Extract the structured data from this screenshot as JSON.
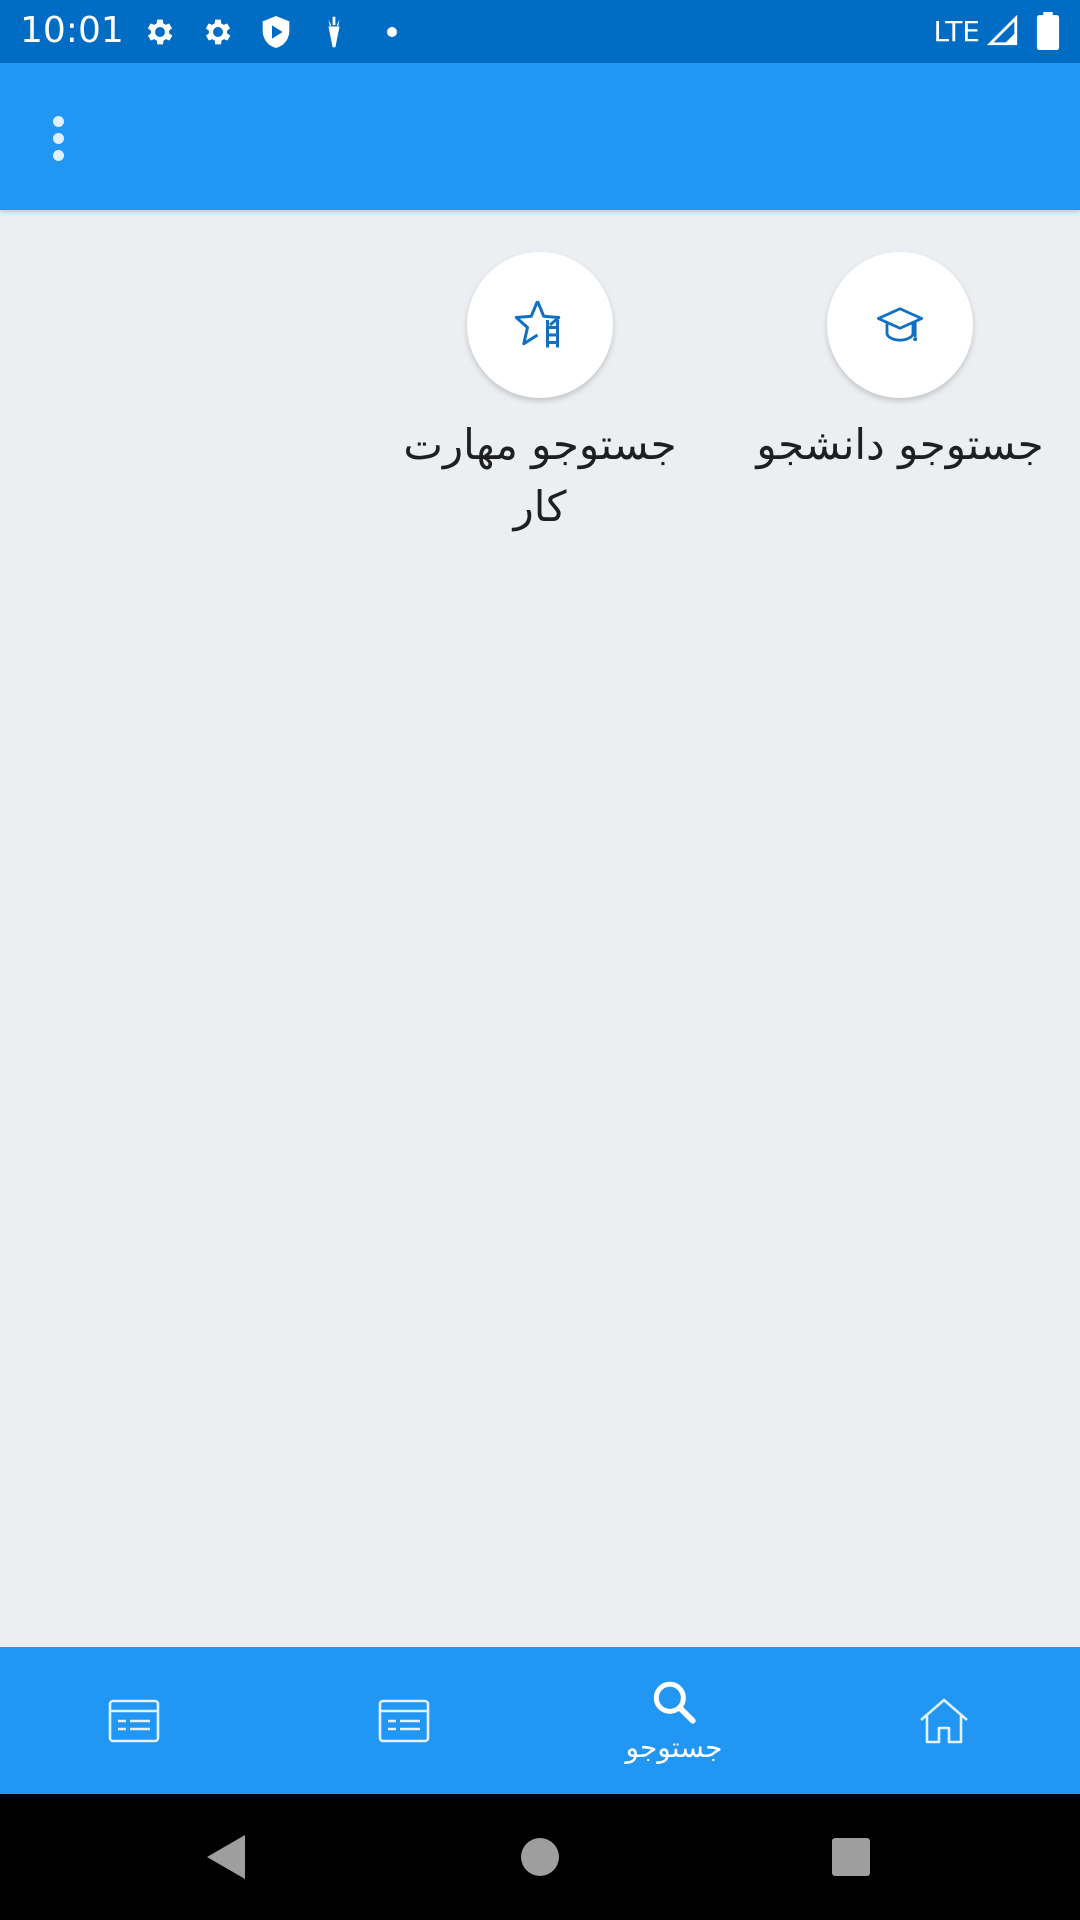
{
  "status_bar": {
    "time": "10:01",
    "network": "LTE",
    "icons": [
      "gear-icon",
      "gear-icon",
      "shield-play-icon",
      "carrot-icon",
      "dot-icon",
      "signal-icon",
      "battery-icon"
    ]
  },
  "app_bar": {
    "menu_icon": "more-vert-icon"
  },
  "tiles": [
    {
      "label": "جستوجو دانشجو",
      "icon": "graduation-cap-icon"
    },
    {
      "label": "جستوجو مهارت کار",
      "icon": "star-ladder-icon"
    }
  ],
  "bottom_nav": {
    "items": [
      {
        "icon": "card-icon",
        "label": ""
      },
      {
        "icon": "card-icon",
        "label": ""
      },
      {
        "icon": "search-icon",
        "label": "جستوجو"
      },
      {
        "icon": "home-icon",
        "label": ""
      }
    ],
    "active_index": 2
  },
  "system_nav": {
    "buttons": [
      "back-icon",
      "home-circle-icon",
      "recents-icon"
    ]
  },
  "colors": {
    "status_bar": "#016cc3",
    "app_bar": "#2196f3",
    "background": "#eceff2",
    "icon_blue": "#1170c4"
  }
}
